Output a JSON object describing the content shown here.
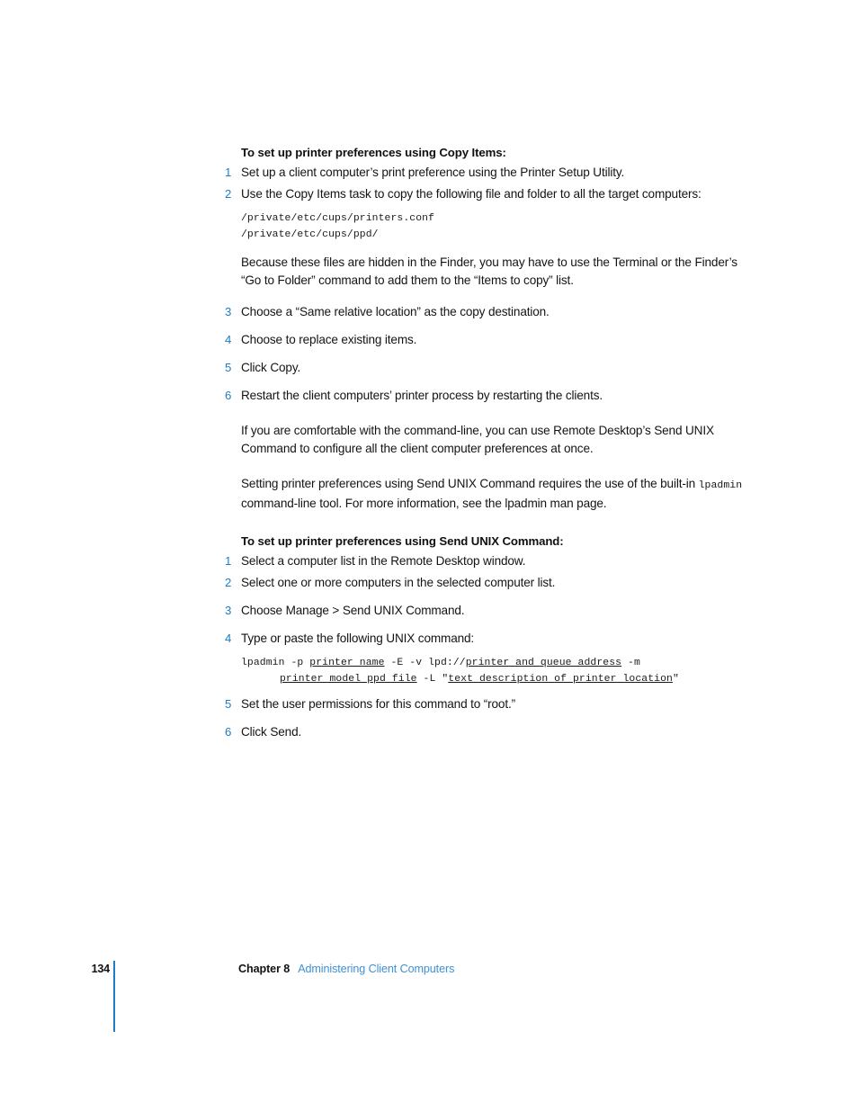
{
  "document": {
    "sections": [
      {
        "heading": "To set up printer preferences using Copy Items:",
        "steps": [
          {
            "num": "1",
            "text": "Set up a client computer’s print preference using the Printer Setup Utility."
          },
          {
            "num": "2",
            "text": "Use the Copy Items task to copy the following file and folder to all the target computers:"
          },
          {
            "num": "3",
            "text": "Choose a “Same relative location” as the copy destination."
          },
          {
            "num": "4",
            "text": "Choose to replace existing items."
          },
          {
            "num": "5",
            "text": "Click Copy."
          },
          {
            "num": "6",
            "text": "Restart the client computers’ printer process by restarting the clients."
          }
        ],
        "code_paths": {
          "line1": "/private/etc/cups/printers.conf",
          "line2": "/private/etc/cups/ppd/"
        },
        "note_paragraph": "Because these files are hidden in the Finder, you may have to use the Terminal or the Finder’s “Go to Folder” command to add them to the “Items to copy” list."
      },
      {
        "heading": "To set up printer preferences using Send UNIX Command:",
        "steps": [
          {
            "num": "1",
            "text": "Select a computer list in the Remote Desktop window."
          },
          {
            "num": "2",
            "text": "Select one or more computers in the selected computer list."
          },
          {
            "num": "3",
            "text": "Choose Manage > Send UNIX Command."
          },
          {
            "num": "4",
            "text": "Type or paste the following UNIX command:"
          },
          {
            "num": "5",
            "text": "Set the user permissions for this command to “root.”"
          },
          {
            "num": "6",
            "text": "Click Send."
          }
        ]
      }
    ],
    "intro_paragraphs": {
      "p1": "If you are comfortable with the command-line, you can use Remote Desktop’s Send UNIX Command to configure all the client computer preferences at once.",
      "p2_before_mono": "Setting printer preferences using Send UNIX Command requires the use of the built-in ",
      "p2_mono": "lpadmin",
      "p2_after_mono": " command-line tool. For more information, see the lpadmin man page."
    },
    "unix_command": {
      "l1_a": "lpadmin -p ",
      "l1_u1": "printer name",
      "l1_b": " -E -v lpd://",
      "l1_u2": "printer and queue address",
      "l1_c": " -m",
      "l2_u1": "printer model ppd file",
      "l2_a": " -L \"",
      "l2_u2": "text description of printer location",
      "l2_b": "\""
    }
  },
  "footer": {
    "page_number": "134",
    "chapter_label": "Chapter 8",
    "chapter_title": "Administering Client Computers"
  },
  "colors": {
    "accent_blue": "#1f7cc4",
    "link_blue": "#3d90d4",
    "body_text": "#141414"
  }
}
